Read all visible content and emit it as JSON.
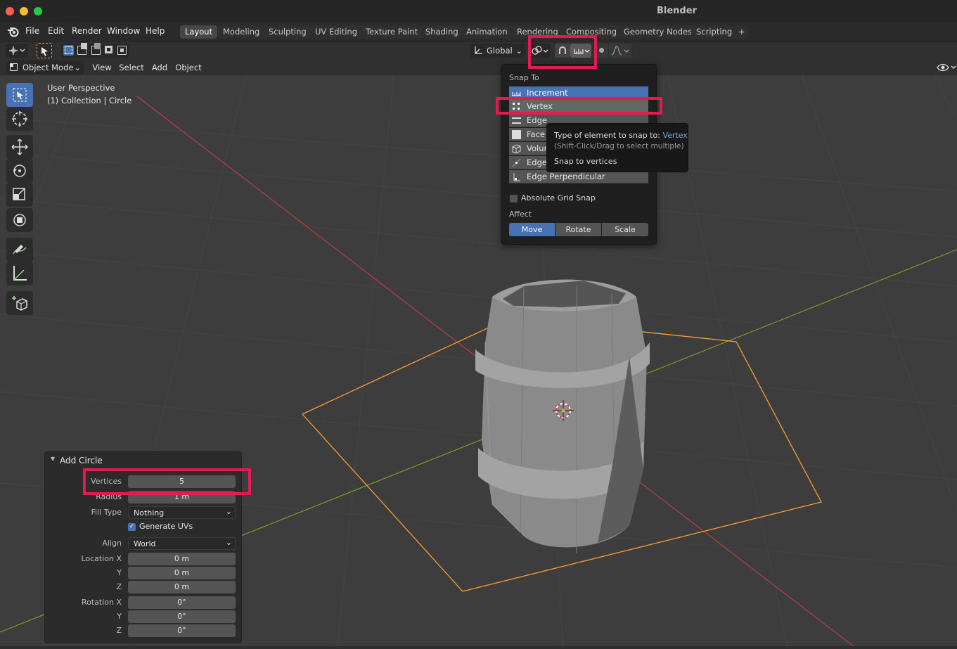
{
  "window": {
    "title": "Blender"
  },
  "menu": [
    "File",
    "Edit",
    "Render",
    "Window",
    "Help"
  ],
  "workspaces": [
    "Layout",
    "Modeling",
    "Sculpting",
    "UV Editing",
    "Texture Paint",
    "Shading",
    "Animation",
    "Rendering",
    "Compositing",
    "Geometry Nodes",
    "Scripting",
    "+"
  ],
  "toolbar": {
    "orientation": "Global"
  },
  "header": {
    "mode": "Object Mode",
    "view": "View",
    "select": "Select",
    "add": "Add",
    "object": "Object"
  },
  "viewport_info": {
    "perspective": "User Perspective",
    "collection": "(1) Collection | Circle"
  },
  "snap_panel": {
    "title": "Snap To",
    "options": [
      "Increment",
      "Vertex",
      "Edge",
      "Face",
      "Volume",
      "Edge",
      "Edge Perpendicular"
    ],
    "absolute_grid": "Absolute Grid Snap",
    "affect_label": "Affect",
    "affect": [
      "Move",
      "Rotate",
      "Scale"
    ]
  },
  "tooltip": {
    "line1": "Type of element to snap to:",
    "value": "Vertex",
    "line2": "(Shift-Click/Drag to select multiple)",
    "line3": "Snap to vertices"
  },
  "op_panel": {
    "title": "Add Circle",
    "vertices_label": "Vertices",
    "vertices": "5",
    "radius_label": "Radius",
    "radius": "1 m",
    "fill_label": "Fill Type",
    "fill": "Nothing",
    "uv_label": "Generate UVs",
    "align_label": "Align",
    "align": "World",
    "loc_x_label": "Location X",
    "loc_x": "0 m",
    "loc_y_label": "Y",
    "loc_y": "0 m",
    "loc_z_label": "Z",
    "loc_z": "0 m",
    "rot_x_label": "Rotation X",
    "rot_x": "0°",
    "rot_y_label": "Y",
    "rot_y": "0°",
    "rot_z_label": "Z",
    "rot_z": "0°"
  },
  "colors": {
    "accent": "#4772b3",
    "highlight": "#e8194d",
    "selection": "#f5a030",
    "x_axis": "#c0394b",
    "y_axis": "#7a9a2e"
  }
}
